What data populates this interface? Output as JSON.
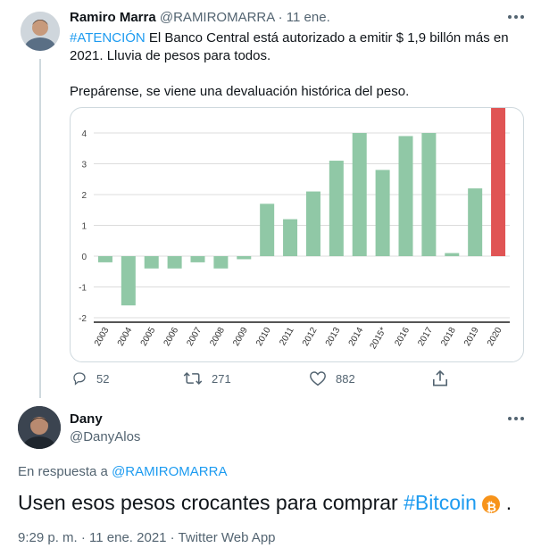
{
  "tweet1": {
    "author_name": "Ramiro Marra",
    "handle": "@RAMIROMARRA",
    "separator": "·",
    "date": "11 ene.",
    "hashtag": "#ATENCIÓN",
    "text_line1": " El Banco Central está autorizado a emitir $ 1,9 billón más en",
    "text_line2": "2021. Lluvia de pesos para todos.",
    "text_line3": "Prepárense, se viene una devaluación histórica del peso.",
    "replies": "52",
    "retweets": "271",
    "likes": "882"
  },
  "tweet2": {
    "author_name": "Dany",
    "handle": "@DanyAlos",
    "reply_prefix": "En respuesta a ",
    "reply_to": "@RAMIROMARRA",
    "text": "Usen esos pesos crocantes para comprar ",
    "hashtag": "#Bitcoin",
    "text_end": " .",
    "bitcoin_glyph": "₿",
    "timestamp": "9:29 p. m. · 11 ene. 2021 · Twitter Web App"
  },
  "colors": {
    "bar_normal": "#90c8a6",
    "bar_highlight": "#e05454",
    "accent": "#1d9bf0",
    "bitcoin": "#f7931a"
  },
  "chart_data": {
    "type": "bar",
    "categories": [
      "2003",
      "2004",
      "2005",
      "2006",
      "2007",
      "2008",
      "2009",
      "2010",
      "2011",
      "2012",
      "2013",
      "2014",
      "2015*",
      "2016",
      "2017",
      "2018",
      "2019",
      "2020"
    ],
    "values": [
      -0.2,
      -1.6,
      -0.4,
      -0.4,
      -0.2,
      -0.4,
      -0.1,
      1.7,
      1.2,
      2.1,
      3.1,
      4.0,
      2.8,
      3.9,
      4.0,
      0.1,
      2.2,
      5.0
    ],
    "highlight_index": 17,
    "yticks": [
      -2,
      -1,
      0,
      1,
      2,
      3,
      4
    ],
    "ylim": [
      -2.3,
      4.9
    ],
    "grid": true
  }
}
